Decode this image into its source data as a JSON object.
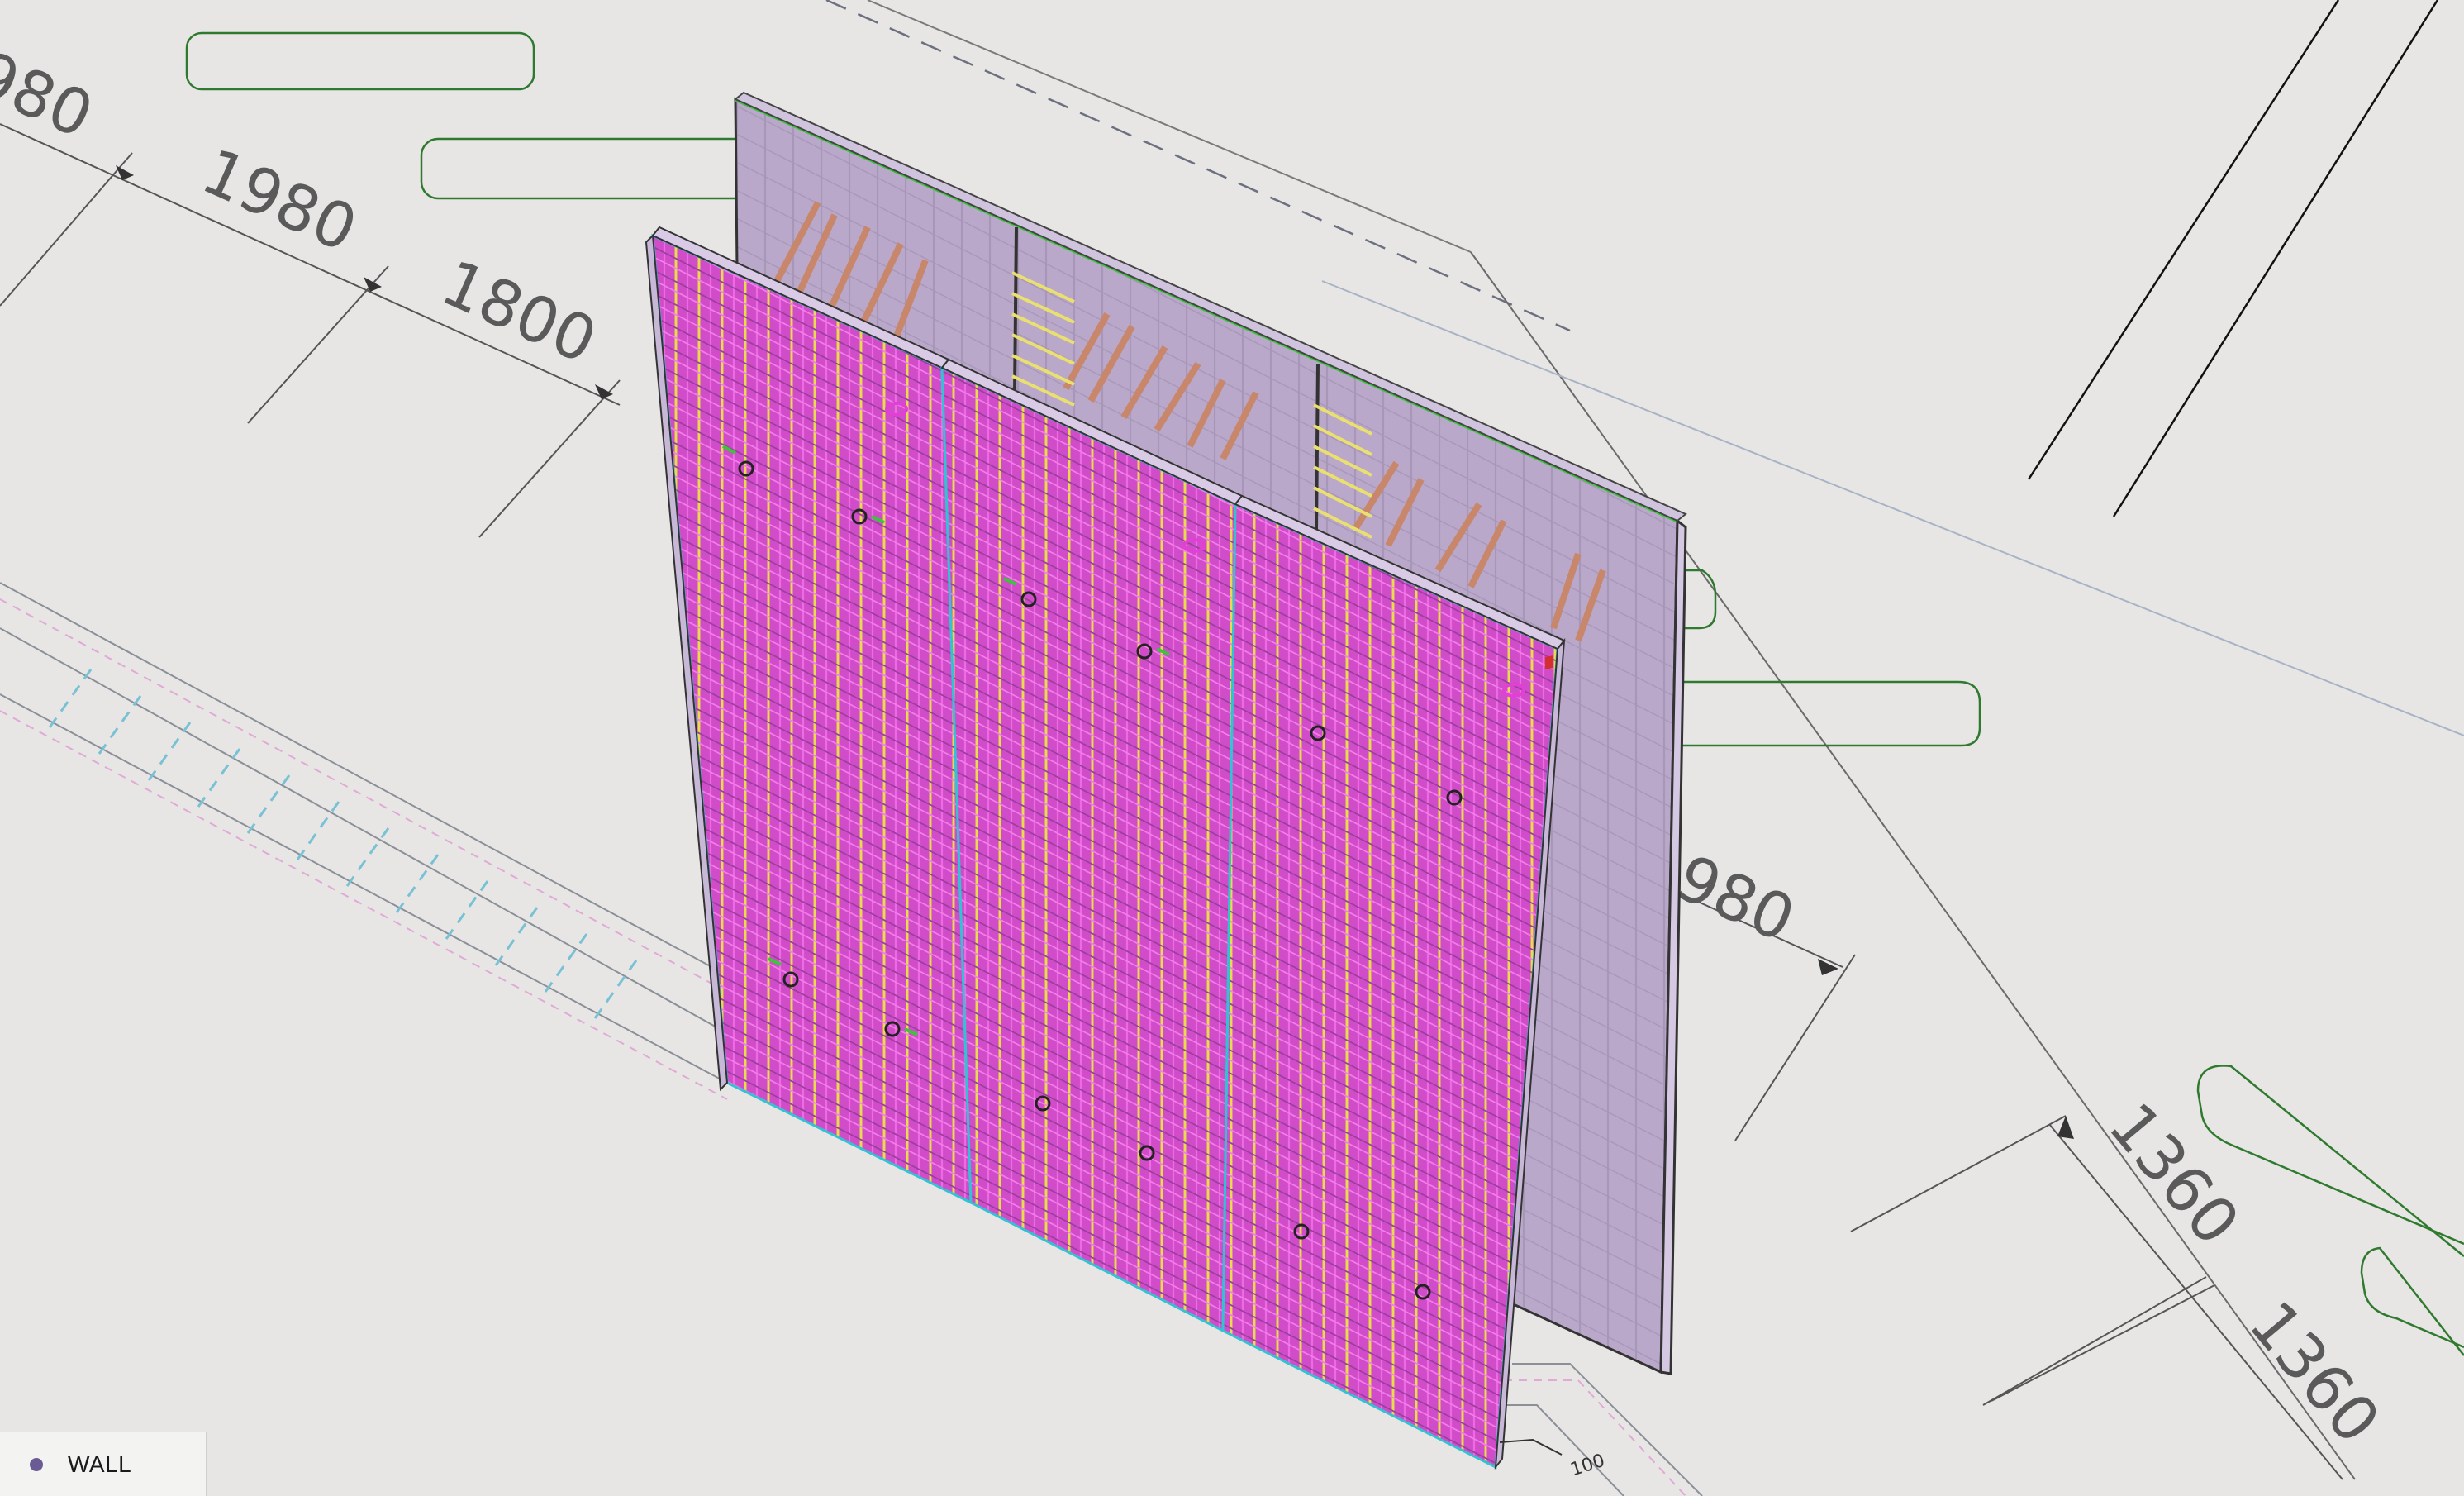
{
  "dimensions": {
    "top": [
      "980",
      "1980",
      "1800"
    ],
    "right": "1980",
    "bottom_right": [
      "1360",
      "1360"
    ],
    "small_tag": "100"
  },
  "legend": {
    "label": "WALL",
    "dot_color": "#6b5b95"
  },
  "colors": {
    "background": "#e7e6e4",
    "wall_body": "#b7a6c8",
    "rebar_magenta": "#e13fd6",
    "rebar_yellow": "#d8d44a",
    "rebar_copper": "#c8866a",
    "outline_green": "#3cc43c",
    "outline_cyan": "#31c3d3"
  }
}
